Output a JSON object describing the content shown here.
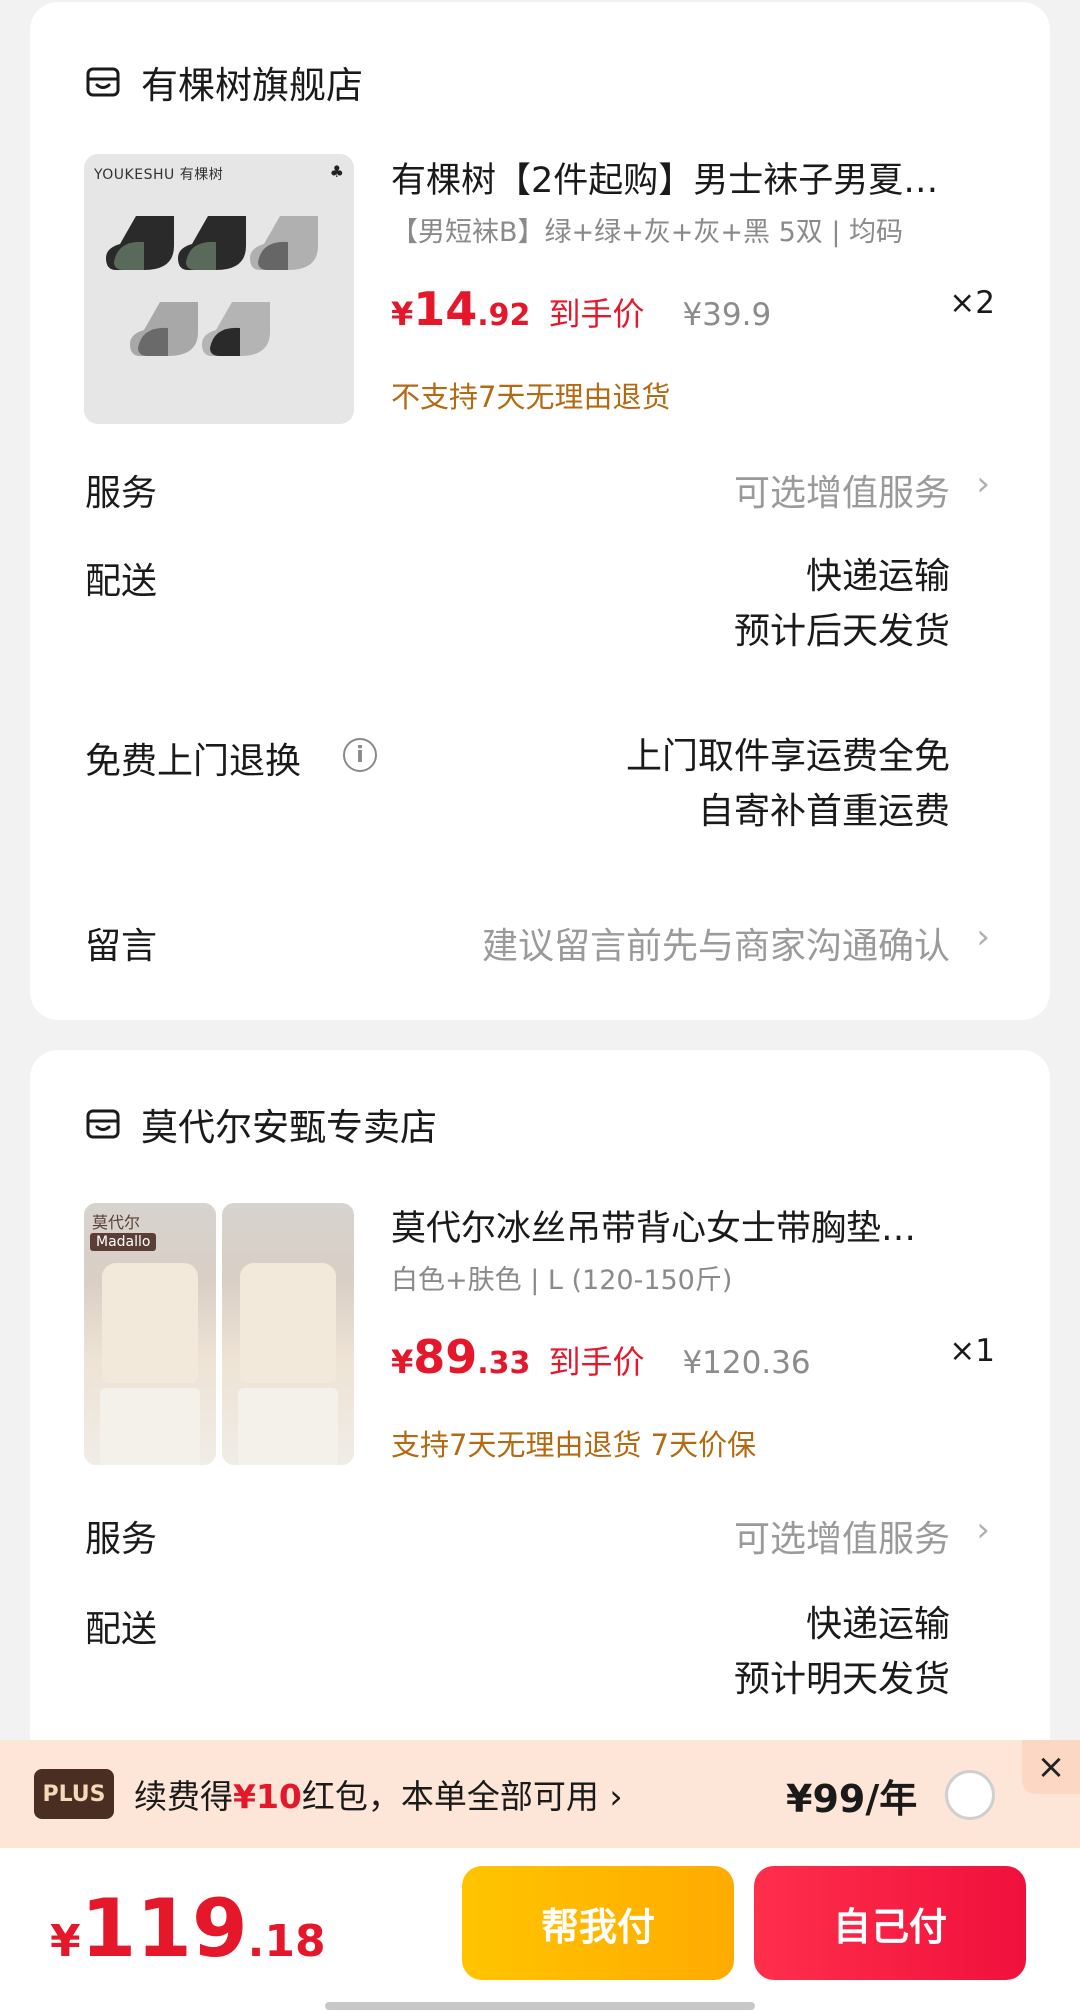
{
  "shops": [
    {
      "name": "有棵树旗舰店",
      "icon": "shop-icon",
      "product": {
        "image_brand": "YOUKESHU 有棵树",
        "title": "有棵树【2件起购】男士袜子男夏…",
        "spec": "【男短袜B】绿+绿+灰+灰+黑 5双 | 均码",
        "price_symbol": "¥",
        "price_int": "14",
        "price_dec": ".92",
        "price_tag": "到手价",
        "orig_price": "¥39.9",
        "qty": "×2",
        "policy": "不支持7天无理由退货"
      },
      "service_label": "服务",
      "service_hint": "可选增值服务",
      "delivery_label": "配送",
      "delivery_line1": "快递运输",
      "delivery_line2": "预计后天发货",
      "return_label": "免费上门退换",
      "return_line1": "上门取件享运费全免",
      "return_line2": "自寄补首重运费",
      "message_label": "留言",
      "message_placeholder": "建议留言前先与商家沟通确认"
    },
    {
      "name": "莫代尔安甄专卖店",
      "icon": "shop-icon",
      "product": {
        "image_brand": "Madallo",
        "image_brand_cn": "莫代尔",
        "title": "莫代尔冰丝吊带背心女士带胸垫…",
        "spec": "白色+肤色 | L (120-150斤)",
        "price_symbol": "¥",
        "price_int": "89",
        "price_dec": ".33",
        "price_tag": "到手价",
        "orig_price": "¥120.36",
        "qty": "×1",
        "policy": "支持7天无理由退货  7天价保"
      },
      "service_label": "服务",
      "service_hint": "可选增值服务",
      "delivery_label": "配送",
      "delivery_line1": "快递运输",
      "delivery_line2": "预计明天发货"
    }
  ],
  "plus_bar": {
    "badge": "PLUS",
    "text_pre": "续费得",
    "text_highlight": "¥10",
    "text_post": "红包，本单全部可用",
    "chevron": "›",
    "price": "¥99/年",
    "close": "×"
  },
  "bottom_bar": {
    "total_symbol": "¥",
    "total_int": "119",
    "total_dec": ".18",
    "help_pay_label": "帮我付",
    "self_pay_label": "自己付"
  },
  "colors": {
    "price_red": "#e4182a",
    "policy_orange": "#b36a12",
    "help_btn": "#ffb800",
    "self_btn": "#f51f45",
    "plus_bg": "#fde6d8"
  }
}
